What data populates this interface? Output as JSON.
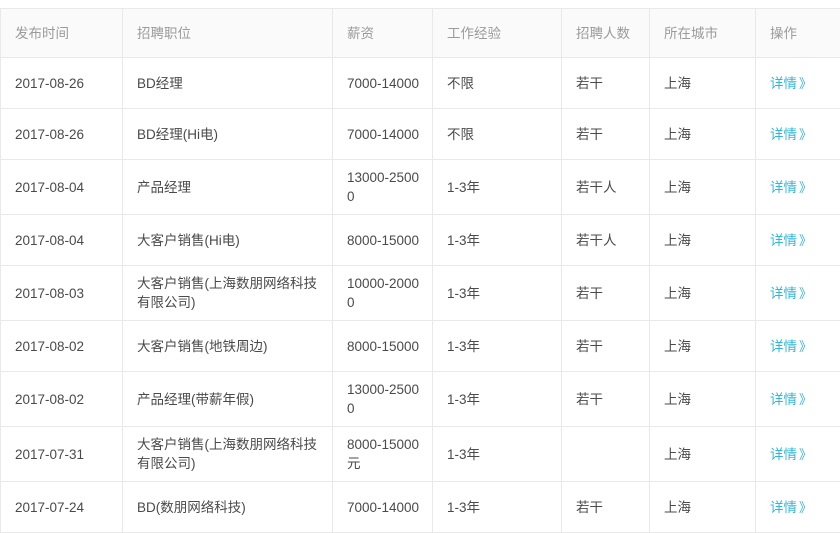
{
  "table": {
    "columns": [
      {
        "key": "publish_time",
        "label": "发布时间"
      },
      {
        "key": "position",
        "label": "招聘职位"
      },
      {
        "key": "salary",
        "label": "薪资"
      },
      {
        "key": "experience",
        "label": "工作经验"
      },
      {
        "key": "headcount",
        "label": "招聘人数"
      },
      {
        "key": "city",
        "label": "所在城市"
      },
      {
        "key": "action",
        "label": "操作"
      }
    ],
    "action_label": "详情",
    "action_chevron": "》",
    "link_color": "#2fb7d6",
    "header_bg": "#fafafa",
    "header_text_color": "#9b9b9b",
    "border_color": "#e9e9e9",
    "rows": [
      {
        "publish_time": "2017-08-26",
        "position": "BD经理",
        "salary": "7000-14000",
        "experience": "不限",
        "headcount": "若干",
        "city": "上海"
      },
      {
        "publish_time": "2017-08-26",
        "position": "BD经理(Hi电)",
        "salary": "7000-14000",
        "experience": "不限",
        "headcount": "若干",
        "city": "上海"
      },
      {
        "publish_time": "2017-08-04",
        "position": "产品经理",
        "salary": "13000-25000",
        "experience": "1-3年",
        "headcount": "若干人",
        "city": "上海"
      },
      {
        "publish_time": "2017-08-04",
        "position": "大客户销售(Hi电)",
        "salary": "8000-15000",
        "experience": "1-3年",
        "headcount": "若干人",
        "city": "上海"
      },
      {
        "publish_time": "2017-08-03",
        "position": "大客户销售(上海数朋网络科技有限公司)",
        "salary": "10000-20000",
        "experience": "1-3年",
        "headcount": "若干",
        "city": "上海"
      },
      {
        "publish_time": "2017-08-02",
        "position": "大客户销售(地铁周边)",
        "salary": "8000-15000",
        "experience": "1-3年",
        "headcount": "若干",
        "city": "上海"
      },
      {
        "publish_time": "2017-08-02",
        "position": "产品经理(带薪年假)",
        "salary": "13000-25000",
        "experience": "1-3年",
        "headcount": "若干",
        "city": "上海"
      },
      {
        "publish_time": "2017-07-31",
        "position": "大客户销售(上海数朋网络科技有限公司)",
        "salary": "8000-15000元",
        "experience": "1-3年",
        "headcount": "",
        "city": "上海"
      },
      {
        "publish_time": "2017-07-24",
        "position": "BD(数朋网络科技)",
        "salary": "7000-14000",
        "experience": "1-3年",
        "headcount": "若干",
        "city": "上海"
      }
    ]
  }
}
